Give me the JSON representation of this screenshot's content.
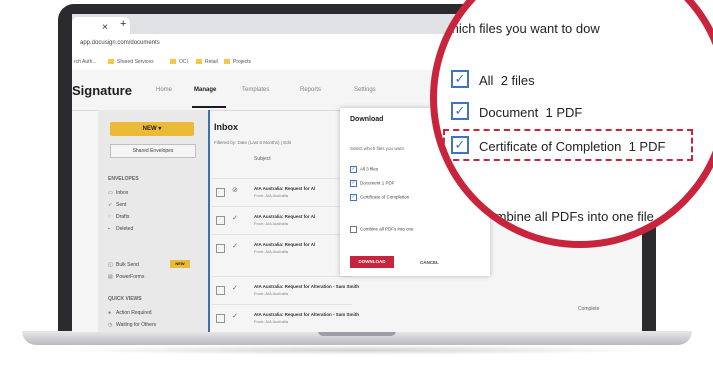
{
  "browser": {
    "tab_close": "×",
    "tab_new": "+",
    "url": "app.docusign.com/documents",
    "bookmarks": [
      "rch Auth...",
      "Shared Services",
      "OCI",
      "Retail",
      "Projects"
    ]
  },
  "app": {
    "brand": "Signature",
    "nav": [
      "Home",
      "Manage",
      "Templates",
      "Reports",
      "Settings"
    ]
  },
  "sidebar": {
    "new_button": "NEW ▾",
    "shared_button": "Shared Envelopes",
    "envelopes_heading": "ENVELOPES",
    "items": [
      "Inbox",
      "Sent",
      "Drafts",
      "Deleted",
      "Bulk Send",
      "PowerForms"
    ],
    "new_badge": "NEW",
    "quick_views_heading": "QUICK VIEWS",
    "quick_items": [
      "Action Required",
      "Waiting for Others"
    ]
  },
  "inbox": {
    "title": "Inbox",
    "filter_text": "Filtered by: Date (Last 6 Months) | Edit",
    "subject_header": "Subject",
    "rows": [
      {
        "subject": "AIA Australia: Request for Al",
        "from": "From: AIA Australia"
      },
      {
        "subject": "AIA Australia: Request for Al",
        "from": "From: AIA Australia"
      },
      {
        "subject": "AIA Australia: Request for Al",
        "from": "From: AIA Australia"
      },
      {
        "subject": "AIA Australia: Request for Alteration - Sam Smith",
        "from": "From: AIA Australia"
      },
      {
        "subject": "AIA Australia: Request for Alteration - Sam Smith",
        "from": "From: AIA Australia"
      }
    ],
    "row_status_right": "Complete"
  },
  "modal": {
    "title": "Download",
    "close": "×",
    "subtitle": "Select which files you want",
    "options": [
      "All 3 files",
      "Document 1 PDF",
      "Certificate of Completion"
    ],
    "combine": "Combine all PDFs into one",
    "download_button": "DOWNLOAD",
    "cancel_button": "CANCEL"
  },
  "magnifier": {
    "heading": "t which files you want to dow",
    "options": [
      {
        "label": "All",
        "detail": "2 files",
        "checked": true
      },
      {
        "label": "Document",
        "detail": "1 PDF",
        "checked": true
      },
      {
        "label": "Certificate of Completion",
        "detail": "1 PDF",
        "checked": true
      }
    ],
    "combine": "Combine all PDFs into one file",
    "check_glyph": "✓",
    "accent_color": "#c8243b",
    "checkbox_color": "#3f73c8"
  }
}
